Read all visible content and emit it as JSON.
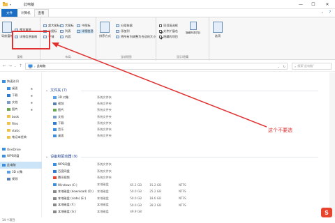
{
  "window": {
    "title": "此电脑",
    "controls": {
      "minimize": "—",
      "maximize": "☐",
      "close": "✕"
    }
  },
  "tabs": [
    "文件",
    "计算机",
    "查看"
  ],
  "ribbon": {
    "pane_group": {
      "label": "窗格",
      "nav_pane": "导航窗格",
      "preview_pane": "预览窗格",
      "details_pane": "详细信息窗格"
    },
    "layout_group": {
      "items": [
        "超大图标",
        "大图标",
        "中图标",
        "小图标",
        "列表",
        "详细信息",
        "平铺",
        "内容"
      ],
      "label": "布局"
    },
    "current_view_group": {
      "sort_by": "排序方式",
      "group_by": "分组依据",
      "add_columns": "添加列",
      "size_all_columns": "将所有列调整为合适的大小",
      "label": "当前视图"
    },
    "show_hide_group": {
      "item_checkboxes": "项目复选框",
      "file_name_extensions": "文件扩展名",
      "hidden_items": "隐藏的项目",
      "hide_selected": "隐藏所选项目",
      "options": "选项",
      "label": "显示/隐藏"
    }
  },
  "address": {
    "path": "此电脑",
    "search_placeholder": "搜索\"此电脑\""
  },
  "nav": {
    "items": [
      {
        "label": "快速访问"
      },
      {
        "label": "桌面"
      },
      {
        "label": "下载"
      },
      {
        "label": "文档"
      },
      {
        "label": "图片"
      },
      {
        "label": "book"
      },
      {
        "label": "Files"
      },
      {
        "label": "static"
      },
      {
        "label": "笔记本经典"
      },
      {
        "label": "OneDrive"
      },
      {
        "label": "WPS网盘"
      },
      {
        "label": "此电脑"
      },
      {
        "label": "3D 对象"
      },
      {
        "label": "视频"
      }
    ]
  },
  "folders": {
    "header": "文件夹 (7)",
    "items": [
      {
        "name": "3D 对象",
        "type": "系统文件夹"
      },
      {
        "name": "视频",
        "type": "系统文件夹"
      },
      {
        "name": "图片",
        "type": "系统文件夹"
      },
      {
        "name": "文档",
        "type": "系统文件夹"
      },
      {
        "name": "下载",
        "type": "系统文件夹"
      },
      {
        "name": "音乐",
        "type": "系统文件夹"
      },
      {
        "name": "桌面",
        "type": "系统文件夹"
      }
    ]
  },
  "devices": {
    "header": "设备和驱动器 (9)",
    "items": [
      {
        "name": "WPS网盘",
        "type": "系统文件夹",
        "total": "",
        "free": "",
        "fs": ""
      },
      {
        "name": "百度网盘",
        "type": "系统文件夹",
        "total": "",
        "free": "",
        "fs": ""
      },
      {
        "name": "腾讯视频",
        "type": "系统文件夹",
        "total": "",
        "free": "",
        "fs": ""
      },
      {
        "name": "Windows (C:)",
        "type": "本地磁盘",
        "total": "65.2 GB",
        "free": "15.2 GB",
        "fs": "NTFS"
      },
      {
        "name": "本地磁盘 (download) (D:)",
        "type": "本地磁盘",
        "total": "50.0 GB",
        "free": "25.2 GB",
        "fs": "NTFS"
      },
      {
        "name": "本地磁盘 (code) (E:)",
        "type": "本地磁盘",
        "total": "50.0 GB",
        "free": "18.6 GB",
        "fs": "NTFS"
      },
      {
        "name": "本地磁盘 (F:)",
        "type": "本地磁盘",
        "total": "50.0 GB",
        "free": "28.2 GB",
        "fs": "NTFS"
      },
      {
        "name": "本地磁盘 (G:)",
        "type": "本地磁盘",
        "total": "49.9 GB",
        "free": "",
        "fs": ""
      }
    ]
  },
  "status": "14 个项目",
  "annotation": "这个不要选",
  "colors": {
    "accent": "#1a6fc4",
    "annotation": "#e03030",
    "folder": "#f0c14b",
    "selection": "#cce4f7"
  }
}
